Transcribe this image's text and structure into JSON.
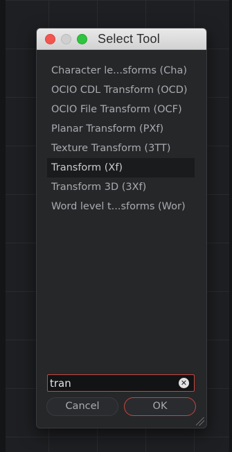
{
  "dialog": {
    "title": "Select Tool",
    "window_controls": [
      "close",
      "minimize",
      "maximize"
    ]
  },
  "list": {
    "items": [
      {
        "label": "Character le...sforms (Cha)",
        "selected": false
      },
      {
        "label": "OCIO CDL Transform (OCD)",
        "selected": false
      },
      {
        "label": "OCIO File Transform (OCF)",
        "selected": false
      },
      {
        "label": "Planar Transform (PXf)",
        "selected": false
      },
      {
        "label": "Texture Transform (3TT)",
        "selected": false
      },
      {
        "label": "Transform (Xf)",
        "selected": true
      },
      {
        "label": "Transform 3D (3Xf)",
        "selected": false
      },
      {
        "label": "Word level t...sforms (Wor)",
        "selected": false
      }
    ]
  },
  "search": {
    "value": "tran",
    "clear_icon": "clear-icon"
  },
  "buttons": {
    "cancel_label": "Cancel",
    "ok_label": "OK"
  },
  "colors": {
    "accent": "#c9473f",
    "panel_bg": "#262729",
    "selected_bg": "#1a1b1d",
    "text": "#a9abb0"
  }
}
